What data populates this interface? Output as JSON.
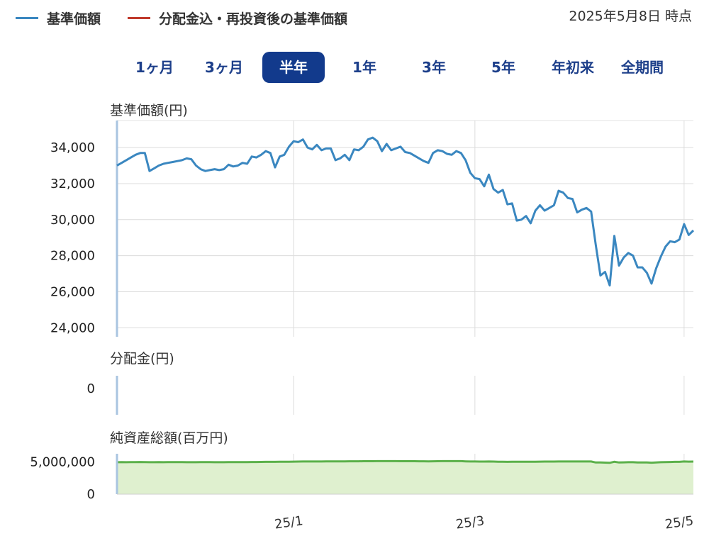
{
  "legend": {
    "items": [
      {
        "label": "基準価額",
        "color": "#3a87c0"
      },
      {
        "label": "分配金込・再投資後の基準価額",
        "color": "#c0392b"
      }
    ]
  },
  "as_of": "2025年5月8日 時点",
  "periods": {
    "items": [
      {
        "label": "1ヶ月",
        "active": false
      },
      {
        "label": "3ヶ月",
        "active": false
      },
      {
        "label": "半年",
        "active": true
      },
      {
        "label": "1年",
        "active": false
      },
      {
        "label": "3年",
        "active": false
      },
      {
        "label": "5年",
        "active": false
      },
      {
        "label": "年初来",
        "active": false
      },
      {
        "label": "全期間",
        "active": false
      }
    ]
  },
  "panels": {
    "nav_title": "基準価額(円)",
    "dist_title": "分配金(円)",
    "assets_title": "純資産総額(百万円)"
  },
  "chart_data": [
    {
      "type": "line",
      "title": "基準価額(円)",
      "ylim": [
        23500,
        35500
      ],
      "yticks": [
        24000,
        26000,
        28000,
        30000,
        32000,
        34000
      ],
      "ytick_labels": [
        "24,000",
        "26,000",
        "28,000",
        "30,000",
        "32,000",
        "34,000"
      ],
      "color": "#3a87c0",
      "x_index_range": [
        0,
        124
      ],
      "x_ticks": [
        {
          "index": 38,
          "label": "25/1"
        },
        {
          "index": 77,
          "label": "25/3"
        },
        {
          "index": 122,
          "label": "25/5"
        }
      ],
      "values": [
        33000,
        33150,
        33300,
        33450,
        33600,
        33700,
        33700,
        32700,
        32850,
        33000,
        33100,
        33150,
        33200,
        33250,
        33300,
        33400,
        33350,
        33000,
        32800,
        32700,
        32750,
        32800,
        32750,
        32800,
        33050,
        32950,
        33000,
        33150,
        33100,
        33500,
        33450,
        33600,
        33800,
        33700,
        32900,
        33500,
        33600,
        34050,
        34350,
        34300,
        34450,
        34000,
        33900,
        34150,
        33850,
        33950,
        33950,
        33300,
        33400,
        33600,
        33300,
        33900,
        33850,
        34050,
        34450,
        34550,
        34350,
        33800,
        34200,
        33850,
        33950,
        34050,
        33750,
        33700,
        33550,
        33400,
        33250,
        33150,
        33700,
        33850,
        33800,
        33650,
        33600,
        33800,
        33700,
        33300,
        32600,
        32300,
        32250,
        31850,
        32500,
        31700,
        31500,
        31650,
        30850,
        30900,
        29950,
        30000,
        30200,
        29800,
        30500,
        30800,
        30500,
        30650,
        30800,
        31600,
        31500,
        31200,
        31150,
        30400,
        30550,
        30650,
        30450,
        28600,
        26900,
        27100,
        26350,
        29100,
        27450,
        27900,
        28150,
        28000,
        27350,
        27350,
        27050,
        26450,
        27300,
        27950,
        28500,
        28800,
        28750,
        28900,
        29750,
        29150,
        29400
      ]
    },
    {
      "type": "bar",
      "title": "分配金(円)",
      "ytick_labels": [
        "0"
      ],
      "values": [
        0
      ]
    },
    {
      "type": "area",
      "title": "純資産総額(百万円)",
      "ylim": [
        0,
        6250000
      ],
      "yticks": [
        0,
        5000000
      ],
      "ytick_labels": [
        "0",
        "5,000,000"
      ],
      "color": "#5bb04a",
      "fill": "#dff0cf",
      "values": [
        4950000,
        4960000,
        4950000,
        4960000,
        4970000,
        4980000,
        4970000,
        4950000,
        4950000,
        4960000,
        4950000,
        4960000,
        4960000,
        4960000,
        4960000,
        4950000,
        4950000,
        4950000,
        4960000,
        4960000,
        4960000,
        4950000,
        4950000,
        4950000,
        4960000,
        4960000,
        4970000,
        4970000,
        4970000,
        4980000,
        4980000,
        4990000,
        5000000,
        5000000,
        5000000,
        5010000,
        5010000,
        5020000,
        5030000,
        5040000,
        5050000,
        5050000,
        5050000,
        5060000,
        5060000,
        5070000,
        5070000,
        5080000,
        5080000,
        5080000,
        5090000,
        5090000,
        5090000,
        5100000,
        5100000,
        5100000,
        5110000,
        5110000,
        5110000,
        5110000,
        5110000,
        5100000,
        5100000,
        5100000,
        5100000,
        5090000,
        5090000,
        5080000,
        5090000,
        5100000,
        5110000,
        5110000,
        5110000,
        5110000,
        5110000,
        5080000,
        5060000,
        5050000,
        5040000,
        5040000,
        5050000,
        5040000,
        5020000,
        5010000,
        5000000,
        5010000,
        5010000,
        5020000,
        5020000,
        5010000,
        5020000,
        5030000,
        5040000,
        5040000,
        5040000,
        5050000,
        5050000,
        5060000,
        5060000,
        5060000,
        5060000,
        5060000,
        5050000,
        4900000,
        4900000,
        4880000,
        4850000,
        5010000,
        4900000,
        4920000,
        4940000,
        4940000,
        4910000,
        4910000,
        4900000,
        4870000,
        4900000,
        4940000,
        4960000,
        4980000,
        5000000,
        5000000,
        5050000,
        5030000,
        5040000
      ]
    }
  ]
}
